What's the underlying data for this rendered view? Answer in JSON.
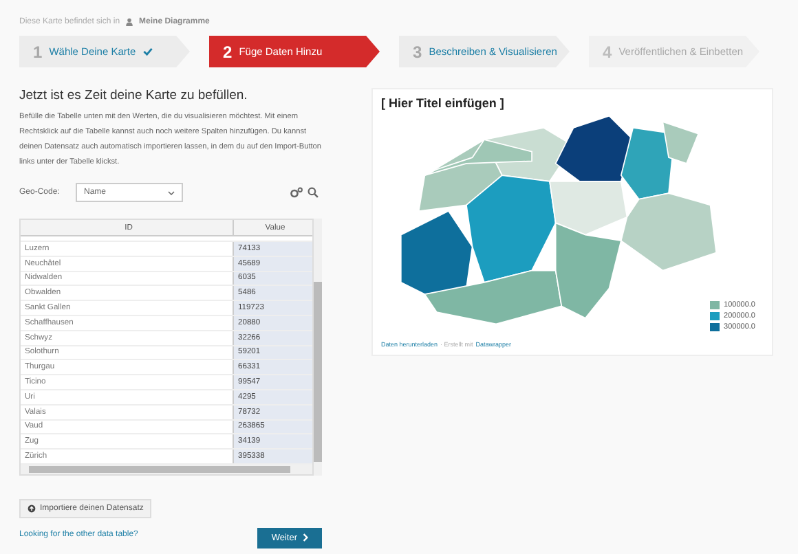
{
  "breadcrumb": {
    "prefix": "Diese Karte befindet sich in",
    "folder": "Meine Diagramme"
  },
  "steps": [
    {
      "number": "1",
      "label": "Wähle Deine Karte",
      "done": true,
      "disabled": false,
      "selected": false
    },
    {
      "number": "2",
      "label": "Füge Daten Hinzu",
      "done": false,
      "disabled": false,
      "selected": true
    },
    {
      "number": "3",
      "label": "Beschreiben & Visualisieren",
      "done": false,
      "disabled": false,
      "selected": false
    },
    {
      "number": "4",
      "label": "Veröffentlichen & Einbetten",
      "done": false,
      "disabled": true,
      "selected": false
    }
  ],
  "heading": "Jetzt ist es Zeit deine Karte zu befüllen.",
  "intro": "Befülle die Tabelle unten mit den Werten, die du visualisieren möchtest. Mit einem Rechtsklick auf die Tabelle kannst auch noch weitere Spalten hinzufügen. Du kannst deinen Datensatz auch automatisch importieren lassen, in dem du auf den Import-Button links unter der Tabelle klickst.",
  "geo_code": {
    "label": "Geo-Code:",
    "value": "Name"
  },
  "table": {
    "columns": [
      "ID",
      "Value"
    ],
    "rows": [
      [
        "Luzern",
        "74133"
      ],
      [
        "Neuchâtel",
        "45689"
      ],
      [
        "Nidwalden",
        "6035"
      ],
      [
        "Obwalden",
        "5486"
      ],
      [
        "Sankt Gallen",
        "119723"
      ],
      [
        "Schaffhausen",
        "20880"
      ],
      [
        "Schwyz",
        "32266"
      ],
      [
        "Solothurn",
        "59201"
      ],
      [
        "Thurgau",
        "66331"
      ],
      [
        "Ticino",
        "99547"
      ],
      [
        "Uri",
        "4295"
      ],
      [
        "Valais",
        "78732"
      ],
      [
        "Vaud",
        "263865"
      ],
      [
        "Zug",
        "34139"
      ],
      [
        "Zürich",
        "395338"
      ]
    ]
  },
  "import_button": "Importiere deinen Datensatz",
  "other_table_link": "Looking for the other data table?",
  "next_button": "Weiter",
  "preview": {
    "title": "[ Hier Titel einfügen ]",
    "legend": [
      {
        "label": "100000.0",
        "color": "#7fb7a4"
      },
      {
        "label": "200000.0",
        "color": "#1c9dbf"
      },
      {
        "label": "300000.0",
        "color": "#0e6f9c"
      }
    ],
    "download_link": "Daten herunterladen",
    "credit": "· Erstellt mit",
    "credit_link": "Datawrapper"
  }
}
